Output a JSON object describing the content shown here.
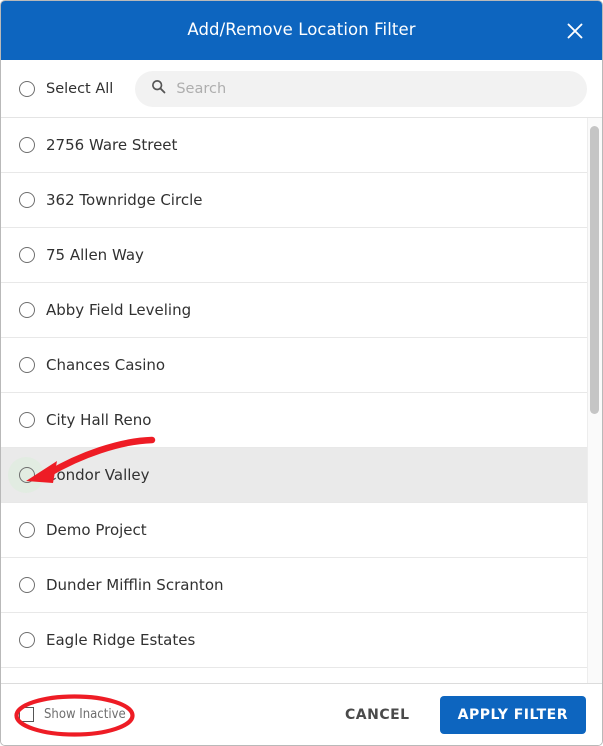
{
  "dialog": {
    "title": "Add/Remove Location Filter",
    "close_icon": "close-icon",
    "header_color": "#0d65bf"
  },
  "toolbar": {
    "select_all_label": "Select All",
    "select_all_checked": false,
    "search": {
      "icon": "search-icon",
      "value": "",
      "placeholder": "Search"
    }
  },
  "list": {
    "hovered_index": 6,
    "items": [
      {
        "label": "2756 Ware Street",
        "selected": false
      },
      {
        "label": "362 Townridge Circle",
        "selected": false
      },
      {
        "label": "75 Allen Way",
        "selected": false
      },
      {
        "label": "Abby Field Leveling",
        "selected": false
      },
      {
        "label": "Chances Casino",
        "selected": false
      },
      {
        "label": "City Hall Reno",
        "selected": false
      },
      {
        "label": "Condor Valley",
        "selected": false
      },
      {
        "label": "Demo Project",
        "selected": false
      },
      {
        "label": "Dunder Mifflin Scranton",
        "selected": false
      },
      {
        "label": "Eagle Ridge Estates",
        "selected": false
      }
    ]
  },
  "footer": {
    "show_inactive_label": "Show Inactive",
    "show_inactive_checked": false,
    "cancel_label": "CANCEL",
    "apply_label": "APPLY FILTER",
    "apply_color": "#0d65bf"
  },
  "annotations": {
    "arrow_color": "#ee1c25",
    "highlight_color": "#ee1c25"
  }
}
